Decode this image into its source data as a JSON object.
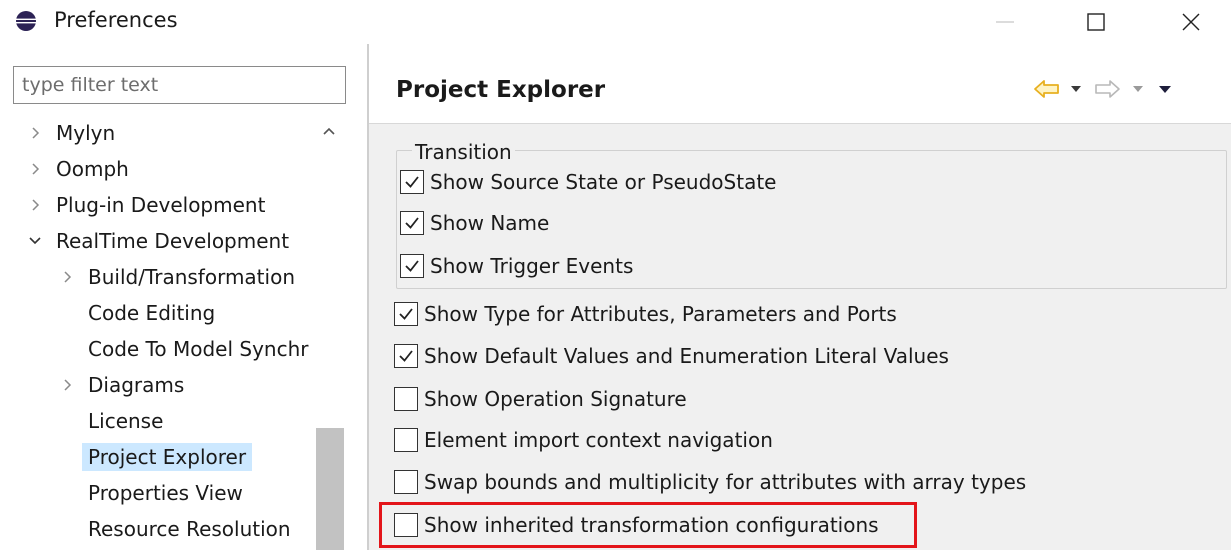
{
  "window": {
    "title": "Preferences",
    "icon": "eclipse-icon",
    "controls": [
      "minimize-icon",
      "maximize-icon",
      "close-icon"
    ]
  },
  "sidebar": {
    "filter_placeholder": "type filter text",
    "tree": [
      {
        "label": "Mylyn",
        "level": 0,
        "expander": "collapsed"
      },
      {
        "label": "Oomph",
        "level": 0,
        "expander": "collapsed"
      },
      {
        "label": "Plug-in Development",
        "level": 0,
        "expander": "collapsed"
      },
      {
        "label": "RealTime Development",
        "level": 0,
        "expander": "expanded"
      },
      {
        "label": "Build/Transformation",
        "level": 1,
        "expander": "collapsed"
      },
      {
        "label": "Code Editing",
        "level": 1,
        "expander": "none"
      },
      {
        "label": "Code To Model Synchr",
        "level": 1,
        "expander": "none"
      },
      {
        "label": "Diagrams",
        "level": 1,
        "expander": "collapsed"
      },
      {
        "label": "License",
        "level": 1,
        "expander": "none"
      },
      {
        "label": "Project Explorer",
        "level": 1,
        "expander": "none",
        "selected": true
      },
      {
        "label": "Properties View",
        "level": 1,
        "expander": "none"
      },
      {
        "label": "Resource Resolution",
        "level": 1,
        "expander": "none"
      }
    ]
  },
  "page": {
    "title": "Project Explorer",
    "nav_icons": [
      "back-arrow-icon",
      "back-dropdown-icon",
      "forward-arrow-icon",
      "forward-dropdown-icon",
      "view-menu-icon"
    ],
    "transition_group": {
      "label": "Transition",
      "options": [
        {
          "label": "Show Source State or PseudoState",
          "checked": true
        },
        {
          "label": "Show Name",
          "checked": true
        },
        {
          "label": "Show Trigger Events",
          "checked": true
        }
      ]
    },
    "options": [
      {
        "label": "Show Type for Attributes, Parameters and Ports",
        "checked": true
      },
      {
        "label": "Show Default Values and Enumeration Literal Values",
        "checked": true
      },
      {
        "label": "Show Operation Signature",
        "checked": false
      },
      {
        "label": "Element import context navigation",
        "checked": false
      },
      {
        "label": "Swap bounds and multiplicity for attributes with array types",
        "checked": false
      },
      {
        "label": "Show inherited transformation configurations",
        "checked": false,
        "highlighted": true
      }
    ]
  },
  "colors": {
    "highlight": "#e3151a",
    "selection": "#cce8ff",
    "back_arrow": "#e8b020",
    "forward_arrow": "#b8b8b8"
  }
}
